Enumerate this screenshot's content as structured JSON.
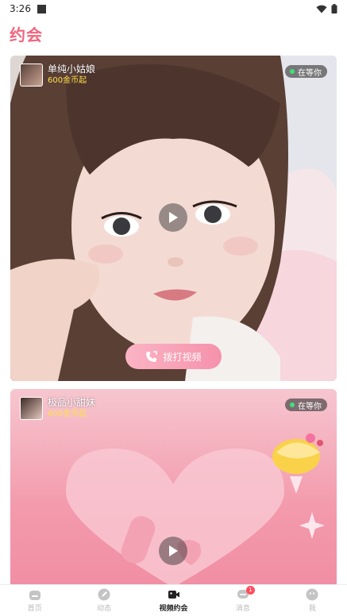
{
  "status_bar": {
    "time": "3:26"
  },
  "page": {
    "title": "约会"
  },
  "cards": [
    {
      "name": "单纯小姑娘",
      "price": "600金币起",
      "status": "在等你",
      "call_label": "拨打视频"
    },
    {
      "name": "极品小甜妹",
      "price": "600金币起",
      "status": "在等你"
    }
  ],
  "tabbar": {
    "items": [
      {
        "label": "首页",
        "icon": "home-icon"
      },
      {
        "label": "动态",
        "icon": "pencil-icon"
      },
      {
        "label": "视频约会",
        "icon": "video-camera-icon"
      },
      {
        "label": "消息",
        "icon": "message-icon",
        "badge": "1"
      },
      {
        "label": "我",
        "icon": "smile-icon"
      }
    ],
    "active_index": 2
  },
  "colors": {
    "accent": "#f2647d",
    "price": "#ffe04d",
    "online_dot": "#3ee07a"
  }
}
